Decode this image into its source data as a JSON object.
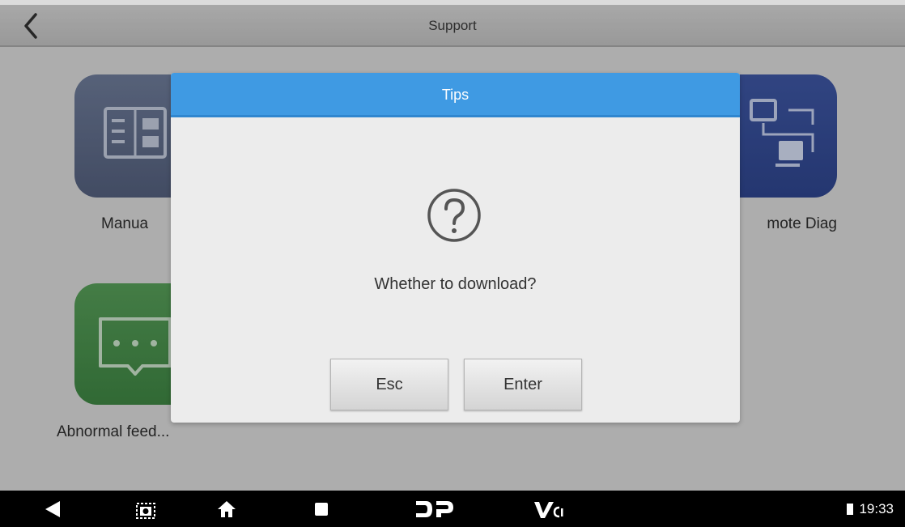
{
  "titlebar": {
    "title": "Support",
    "back_icon": "chevron-left-icon"
  },
  "tiles": {
    "manual": {
      "label": "Manua",
      "icon": "manual-book-icon",
      "color": "#5f6c8c"
    },
    "remote": {
      "label": "mote Diag",
      "icon": "remote-diag-icon",
      "color": "#364d98"
    },
    "feedback": {
      "label": "Abnormal feed...",
      "icon": "feedback-chat-icon",
      "color": "#4a944e"
    }
  },
  "dialog": {
    "title": "Tips",
    "icon": "question-circle-icon",
    "message": "Whether to download?",
    "esc_label": "Esc",
    "enter_label": "Enter",
    "header_color": "#3f9ae3"
  },
  "systembar": {
    "icons": [
      "back-triangle-icon",
      "screenshot-icon",
      "home-icon",
      "recent-apps-icon",
      "dp-logo-icon",
      "vci-icon"
    ],
    "time": "19:33",
    "battery_icon": "battery-icon"
  }
}
